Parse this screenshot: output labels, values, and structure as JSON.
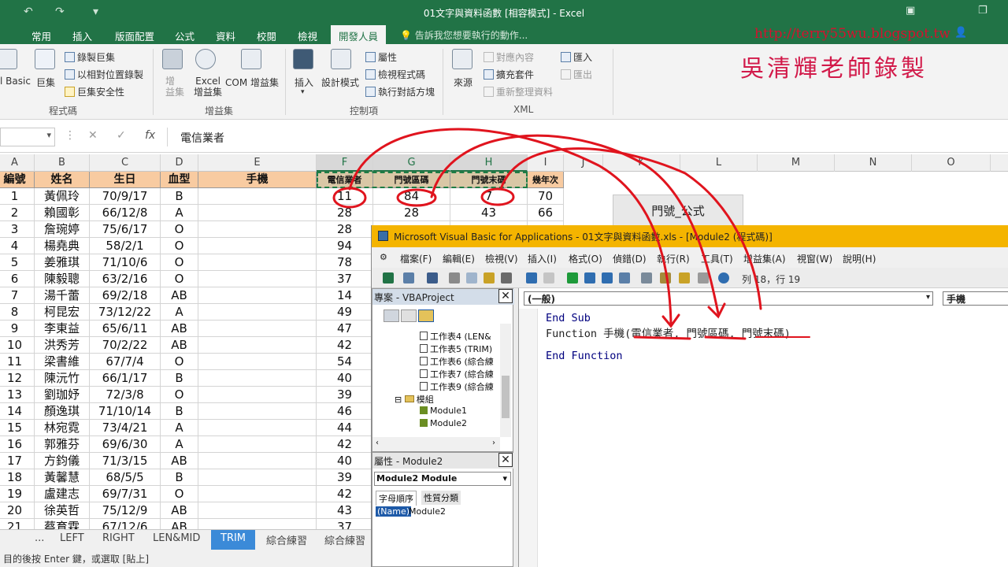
{
  "window": {
    "title": "01文字與資料函數  [相容模式] - Excel"
  },
  "watermark": {
    "url": "http://terry55wu.blogspot.tw",
    "author": "吳清輝老師錄製"
  },
  "tabs": [
    "常用",
    "插入",
    "版面配置",
    "公式",
    "資料",
    "校閱",
    "檢視",
    "開發人員"
  ],
  "tell_me": "告訴我您想要執行的動作...",
  "ribbon": {
    "code_group": "程式碼",
    "visual_basic": "l Basic",
    "macros": "巨集",
    "record_macro": "錄製巨集",
    "relative_ref": "以相對位置錄製",
    "macro_security": "巨集安全性",
    "addins_group": "增益集",
    "addins": "增\n益集",
    "excel_addins": "Excel\n增益集",
    "com_addins": "COM 增益集",
    "controls_group": "控制項",
    "insert": "插入",
    "design_mode": "設計模式",
    "properties": "屬性",
    "view_code": "檢視程式碼",
    "run_dialog": "執行對話方塊",
    "xml_group": "XML",
    "source": "來源",
    "map_props": "對應內容",
    "expansion": "擴充套件",
    "refresh": "重新整理資料",
    "import": "匯入",
    "export": "匯出"
  },
  "formula_bar": {
    "fx": "fx",
    "value": "電信業者"
  },
  "columns": [
    "A",
    "B",
    "C",
    "D",
    "E",
    "F",
    "G",
    "H",
    "I",
    "J",
    "K",
    "L",
    "M",
    "N",
    "O"
  ],
  "table": {
    "headers": [
      "編號",
      "姓名",
      "生日",
      "血型",
      "手機",
      "電信業者",
      "門號區碼",
      "門號末碼",
      "幾年次"
    ],
    "rows": [
      [
        "1",
        "黃佩玲",
        "70/9/17",
        "B",
        "",
        "11",
        "84",
        "7",
        "70"
      ],
      [
        "2",
        "賴國彰",
        "66/12/8",
        "A",
        "",
        "28",
        "28",
        "43",
        "66"
      ],
      [
        "3",
        "詹琬婷",
        "75/6/17",
        "O",
        "",
        "28",
        "",
        "",
        ""
      ],
      [
        "4",
        "楊堯典",
        "58/2/1",
        "O",
        "",
        "94",
        "",
        "",
        ""
      ],
      [
        "5",
        "姜雅琪",
        "71/10/6",
        "O",
        "",
        "78",
        "",
        "",
        ""
      ],
      [
        "6",
        "陳毅聰",
        "63/2/16",
        "O",
        "",
        "37",
        "",
        "",
        ""
      ],
      [
        "7",
        "湯千蕾",
        "69/2/18",
        "AB",
        "",
        "14",
        "",
        "",
        ""
      ],
      [
        "8",
        "柯昆宏",
        "73/12/22",
        "A",
        "",
        "49",
        "",
        "",
        ""
      ],
      [
        "9",
        "李東益",
        "65/6/11",
        "AB",
        "",
        "47",
        "",
        "",
        ""
      ],
      [
        "10",
        "洪秀芳",
        "70/2/22",
        "AB",
        "",
        "42",
        "",
        "",
        ""
      ],
      [
        "11",
        "梁書維",
        "67/7/4",
        "O",
        "",
        "54",
        "",
        "",
        ""
      ],
      [
        "12",
        "陳沅竹",
        "66/1/17",
        "B",
        "",
        "40",
        "",
        "",
        ""
      ],
      [
        "13",
        "劉珈妤",
        "72/3/8",
        "O",
        "",
        "39",
        "",
        "",
        ""
      ],
      [
        "14",
        "顏逸琪",
        "71/10/14",
        "B",
        "",
        "46",
        "",
        "",
        ""
      ],
      [
        "15",
        "林宛霓",
        "73/4/21",
        "A",
        "",
        "44",
        "",
        "",
        ""
      ],
      [
        "16",
        "郭雅芬",
        "69/6/30",
        "A",
        "",
        "42",
        "",
        "",
        ""
      ],
      [
        "17",
        "方鈞儀",
        "71/3/15",
        "AB",
        "",
        "40",
        "",
        "",
        ""
      ],
      [
        "18",
        "黃馨慧",
        "68/5/5",
        "B",
        "",
        "39",
        "",
        "",
        ""
      ],
      [
        "19",
        "盧建志",
        "69/7/31",
        "O",
        "",
        "42",
        "",
        "",
        ""
      ],
      [
        "20",
        "徐英哲",
        "75/12/9",
        "AB",
        "",
        "43",
        "",
        "",
        ""
      ],
      [
        "21",
        "蔡育霖",
        "67/12/6",
        "AB",
        "",
        "37",
        "",
        "",
        ""
      ]
    ]
  },
  "float_button": "門號_公式",
  "sheet_tabs": [
    "...",
    "LEFT",
    "RIGHT",
    "LEN&MID",
    "TRIM",
    "綜合練習",
    "綜合練習"
  ],
  "status_text": "目的後按 Enter 鍵，或選取 [貼上]",
  "vbe": {
    "title": "Microsoft Visual Basic for Applications - 01文字與資料函數.xls - [Module2 (程式碼)]",
    "menu": [
      "檔案(F)",
      "編輯(E)",
      "檢視(V)",
      "插入(I)",
      "格式(O)",
      "偵錯(D)",
      "執行(R)",
      "工具(T)",
      "增益集(A)",
      "視窗(W)",
      "說明(H)"
    ],
    "position": "列 18，行 19",
    "project_title": "專案 - VBAProject",
    "tree": [
      "工作表4 (LEN&",
      "工作表5 (TRIM)",
      "工作表6 (綜合練",
      "工作表7 (綜合練",
      "工作表9 (綜合練",
      "模組",
      "Module1",
      "Module2"
    ],
    "props_title": "屬性 - Module2",
    "props_object": "Module2 Module",
    "props_tabs": [
      "字母順序",
      "性質分類"
    ],
    "prop_name": "(Name)",
    "prop_value": "Module2",
    "combo_left": "(一般)",
    "combo_right": "手機",
    "code": [
      "End Sub",
      "Function 手機(電信業者, 門號區碼, 門號末碼)",
      "",
      "End Function"
    ]
  }
}
